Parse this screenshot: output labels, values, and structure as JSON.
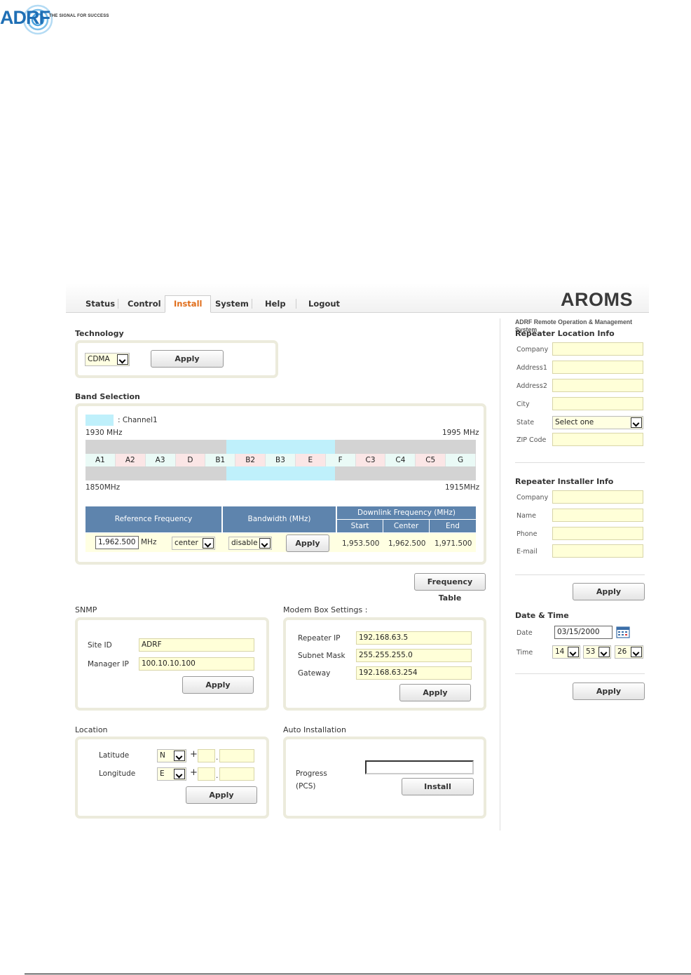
{
  "header": {
    "logo_text": "ADRF",
    "tagline": "THE SIGNAL FOR SUCCESS"
  },
  "app": {
    "brand": "AROMS",
    "brand_sub": "ADRF Remote Operation & Management System",
    "tabs": [
      "Status",
      "Control",
      "Install",
      "System",
      "Help",
      "Logout"
    ],
    "active_tab": "Install"
  },
  "technology": {
    "title": "Technology",
    "selected": "CDMA",
    "apply_label": "Apply"
  },
  "band_selection": {
    "title": "Band Selection",
    "legend_label": ": Channel1",
    "legend_color": "#bff0fb",
    "top_left_freq": "1930 MHz",
    "top_right_freq": "1995 MHz",
    "bottom_left_freq": "1850MHz",
    "bottom_right_freq": "1915MHz",
    "bands": [
      {
        "label": "A1",
        "color": "#eafaf6"
      },
      {
        "label": "A2",
        "color": "#fbe6e6"
      },
      {
        "label": "A3",
        "color": "#eafaf6"
      },
      {
        "label": "D",
        "color": "#fbe6e6"
      },
      {
        "label": "B1",
        "color": "#eafaf6"
      },
      {
        "label": "B2",
        "color": "#fbe6e6"
      },
      {
        "label": "B3",
        "color": "#eafaf6"
      },
      {
        "label": "E",
        "color": "#fbe6e6"
      },
      {
        "label": "F",
        "color": "#eafaf6"
      },
      {
        "label": "C3",
        "color": "#fbe6e6"
      },
      {
        "label": "C4",
        "color": "#eafaf6"
      },
      {
        "label": "C5",
        "color": "#fbe6e6"
      },
      {
        "label": "G",
        "color": "#eafaf6"
      }
    ],
    "table": {
      "col_ref": "Reference Frequency",
      "col_bw": "Bandwidth (MHz)",
      "col_dl": "Downlink Frequency (MHz)",
      "col_start": "Start",
      "col_center": "Center",
      "col_end": "End",
      "ref_value": "1,962.500",
      "ref_unit": "MHz",
      "ref_mode": "center",
      "bandwidth": "disable",
      "apply_label": "Apply",
      "start": "1,953.500",
      "center": "1,962.500",
      "end": "1,971.500"
    },
    "freq_table_button": "Frequency Table"
  },
  "snmp": {
    "title": "SNMP",
    "site_id_label": "Site ID",
    "site_id": "ADRF",
    "manager_ip_label": "Manager IP",
    "manager_ip": "100.10.10.100",
    "apply_label": "Apply"
  },
  "modem": {
    "title": "Modem Box Settings :",
    "repeater_ip_label": "Repeater IP",
    "repeater_ip": "192.168.63.5",
    "subnet_label": "Subnet Mask",
    "subnet": "255.255.255.0",
    "gateway_label": "Gateway",
    "gateway": "192.168.63.254",
    "apply_label": "Apply"
  },
  "location": {
    "title": "Location",
    "latitude_label": "Latitude",
    "latitude_dir": "N",
    "longitude_label": "Longitude",
    "longitude_dir": "E",
    "plus": "+",
    "dot": ".",
    "apply_label": "Apply"
  },
  "auto_install": {
    "title": "Auto Installation",
    "progress_label": "Progress",
    "progress_sub": "(PCS)",
    "progress_value": 0,
    "install_label": "Install"
  },
  "repeater_location": {
    "title": "Repeater Location Info",
    "company_label": "Company",
    "address1_label": "Address1",
    "address2_label": "Address2",
    "city_label": "City",
    "state_label": "State",
    "state_value": "Select one",
    "zip_label": "ZIP Code"
  },
  "installer": {
    "title": "Repeater Installer Info",
    "company_label": "Company",
    "name_label": "Name",
    "phone_label": "Phone",
    "email_label": "E-mail",
    "apply_label": "Apply"
  },
  "date_time": {
    "title": "Date & Time",
    "date_label": "Date",
    "date": "03/15/2000",
    "time_label": "Time",
    "hour": "14",
    "minute": "53",
    "second": "26",
    "apply_label": "Apply"
  }
}
